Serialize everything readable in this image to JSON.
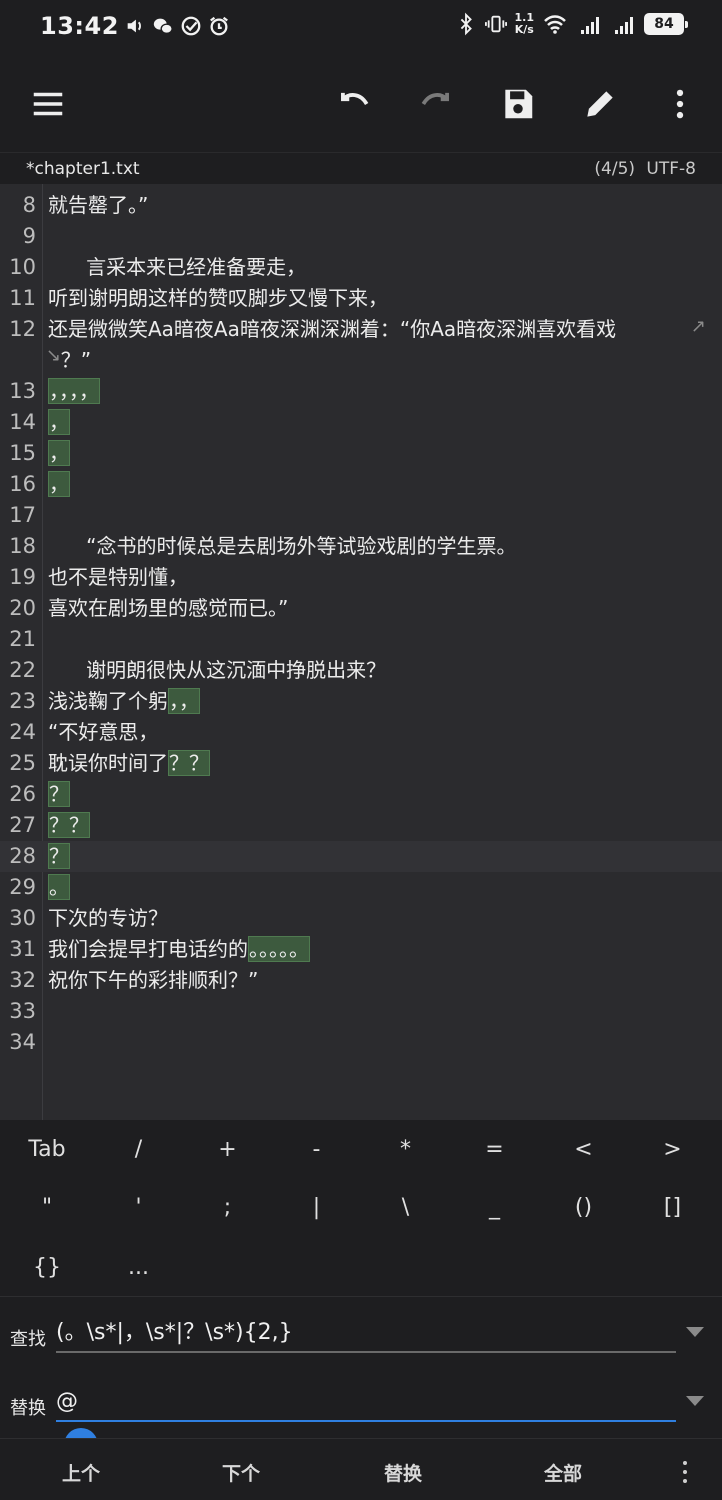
{
  "status_bar": {
    "time": "13:42",
    "net_speed_top": "1.1",
    "net_speed_bottom": "K/s",
    "battery": "84"
  },
  "toolbar": {
    "icons": [
      "menu-icon",
      "undo-icon",
      "redo-icon",
      "save-icon",
      "edit-icon",
      "more-vert-icon"
    ]
  },
  "file": {
    "name": "*chapter1.txt",
    "info": "(4/5) UTF-8"
  },
  "editor": {
    "lines": [
      {
        "n": "8",
        "parts": [
          {
            "t": "就告罄了。”",
            "hl": false
          }
        ]
      },
      {
        "n": "9",
        "parts": []
      },
      {
        "n": "10",
        "parts": [
          {
            "t": "      言采本来已经准备要走，",
            "hl": false
          }
        ]
      },
      {
        "n": "11",
        "parts": [
          {
            "t": "听到谢明朗这样的赞叹脚步又慢下来，",
            "hl": false
          }
        ]
      },
      {
        "n": "12",
        "parts": [
          {
            "t": "还是微微笑Aa暗夜Aa暗夜深渊深渊着：“你Aa暗夜深渊喜欢看戏",
            "hl": false
          }
        ]
      },
      {
        "n": "",
        "parts": [
          {
            "t": "  ？”",
            "hl": false
          }
        ]
      },
      {
        "n": "13",
        "parts": [
          {
            "t": "，，，，",
            "hl": true
          }
        ]
      },
      {
        "n": "14",
        "parts": [
          {
            "t": "，",
            "hl": true
          }
        ]
      },
      {
        "n": "15",
        "parts": [
          {
            "t": "，",
            "hl": true
          }
        ]
      },
      {
        "n": "16",
        "parts": [
          {
            "t": "，",
            "hl": true
          }
        ]
      },
      {
        "n": "17",
        "parts": []
      },
      {
        "n": "18",
        "parts": [
          {
            "t": "      “念书的时候总是去剧场外等试验戏剧的学生票。",
            "hl": false
          }
        ]
      },
      {
        "n": "19",
        "parts": [
          {
            "t": "也不是特别懂，",
            "hl": false
          }
        ]
      },
      {
        "n": "20",
        "parts": [
          {
            "t": "喜欢在剧场里的感觉而已。”",
            "hl": false
          }
        ]
      },
      {
        "n": "21",
        "parts": []
      },
      {
        "n": "22",
        "parts": [
          {
            "t": "      谢明朗很快从这沉湎中挣脱出来？",
            "hl": false
          }
        ]
      },
      {
        "n": "23",
        "parts": [
          {
            "t": "浅浅鞠了个躬",
            "hl": false
          },
          {
            "t": "，，",
            "hl": true
          }
        ]
      },
      {
        "n": "24",
        "parts": [
          {
            "t": "“不好意思，",
            "hl": false
          }
        ]
      },
      {
        "n": "25",
        "parts": [
          {
            "t": "耽误你时间了",
            "hl": false
          },
          {
            "t": "？？",
            "hl": true
          }
        ]
      },
      {
        "n": "26",
        "parts": [
          {
            "t": "？",
            "hl": true
          }
        ]
      },
      {
        "n": "27",
        "parts": [
          {
            "t": "？？",
            "hl": true
          }
        ]
      },
      {
        "n": "28",
        "parts": [
          {
            "t": "？",
            "hl": true
          }
        ]
      },
      {
        "n": "29",
        "parts": [
          {
            "t": "。",
            "hl": true
          }
        ]
      },
      {
        "n": "30",
        "parts": [
          {
            "t": "下次的专访？",
            "hl": false
          }
        ]
      },
      {
        "n": "31",
        "parts": [
          {
            "t": "我们会提早打电话约的",
            "hl": false
          },
          {
            "t": "。。。。。",
            "hl": true
          }
        ]
      },
      {
        "n": "32",
        "parts": [
          {
            "t": "祝你下午的彩排顺利？”",
            "hl": false
          }
        ]
      },
      {
        "n": "33",
        "parts": []
      },
      {
        "n": "34",
        "parts": []
      }
    ]
  },
  "symbols": {
    "row1": [
      "Tab",
      "/",
      "+",
      "-",
      "*",
      "=",
      "<",
      ">"
    ],
    "row2": [
      "\"",
      "'",
      ";",
      "|",
      "\\",
      "_",
      "()",
      "[]"
    ],
    "row3": [
      "{}",
      "..."
    ]
  },
  "find": {
    "label": "查找",
    "value": "(。\\s*|，\\s*|？\\s*){2,}"
  },
  "replace": {
    "label": "替换",
    "value": "@"
  },
  "actions": {
    "prev": "上个",
    "next": "下个",
    "replace": "替换",
    "all": "全部"
  }
}
